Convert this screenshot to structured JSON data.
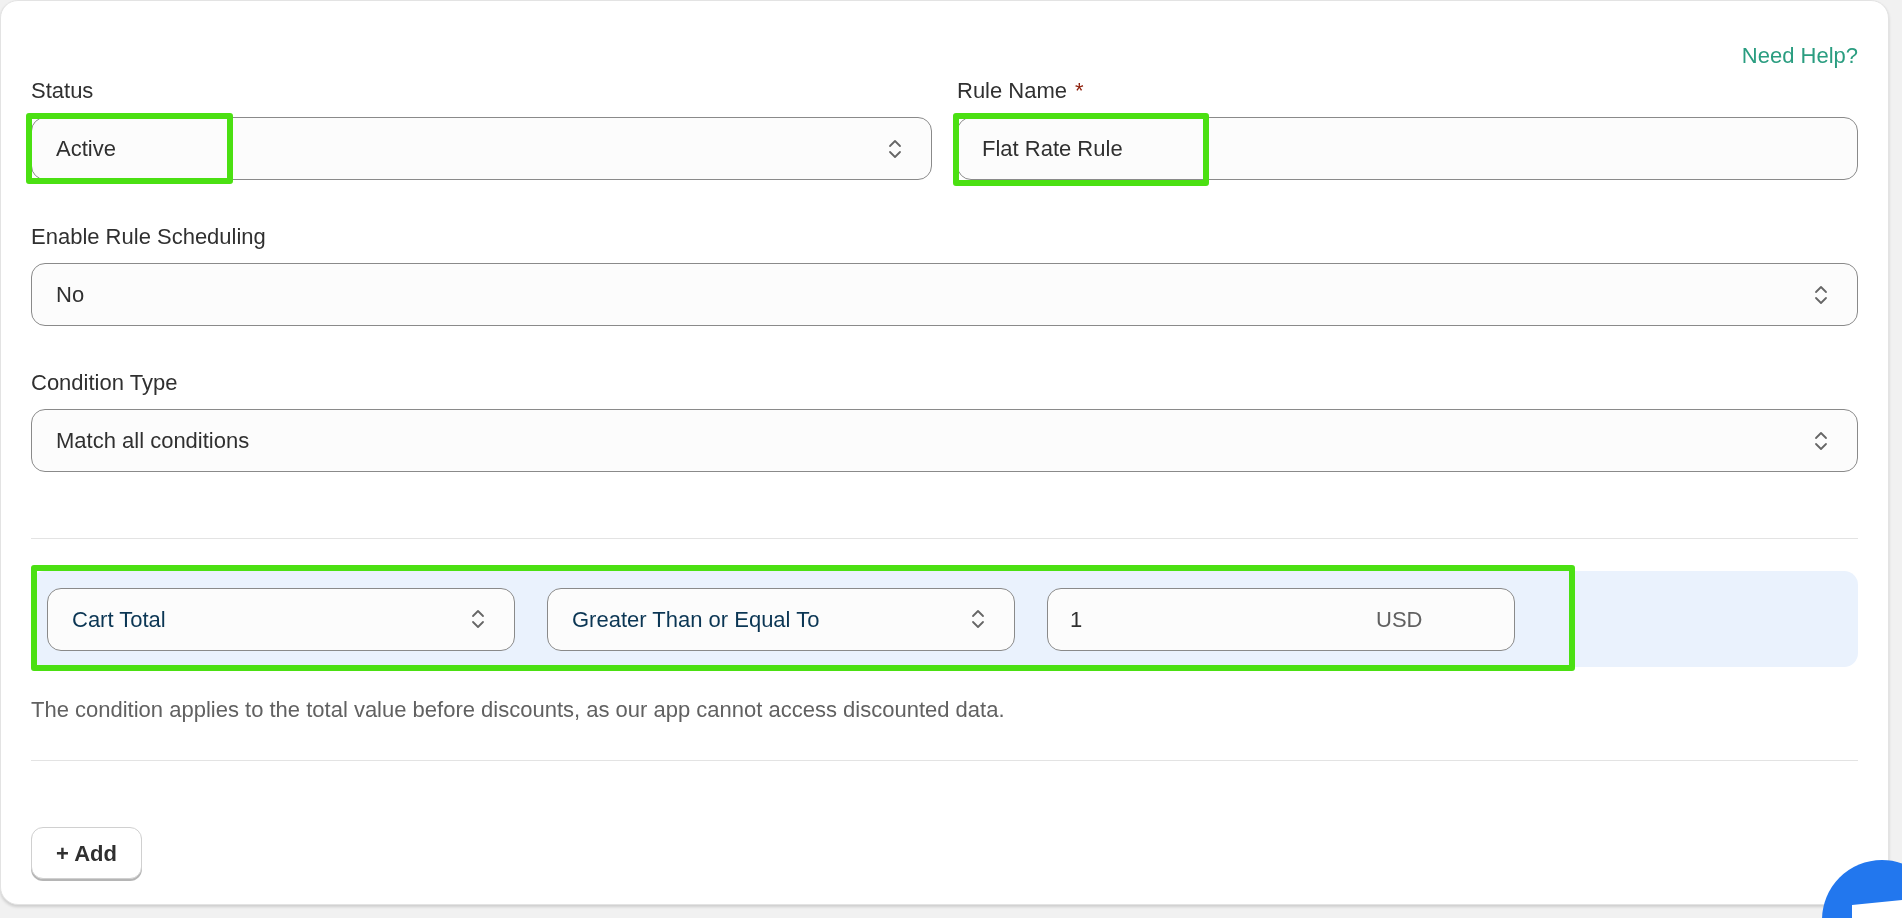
{
  "help_link": "Need Help?",
  "top_row": [
    {
      "kind": "select",
      "label": "Status",
      "value": "Active",
      "highlighted": true
    },
    {
      "kind": "text",
      "label": "Rule Name",
      "required_mark": "*",
      "value": "Flat Rate Rule",
      "highlighted": true
    }
  ],
  "fields": [
    {
      "kind": "select",
      "label": "Enable Rule Scheduling",
      "value": "No",
      "highlighted": false
    },
    {
      "kind": "select",
      "label": "Condition Type",
      "value": "Match all conditions",
      "highlighted": false
    }
  ],
  "condition": {
    "highlighted": true,
    "field": "Cart Total",
    "operator": "Greater Than or Equal To",
    "value": "1",
    "unit": "USD"
  },
  "note": "The condition applies to the total value before discounts, as our app cannot access discounted data.",
  "add_button": "+ Add"
}
